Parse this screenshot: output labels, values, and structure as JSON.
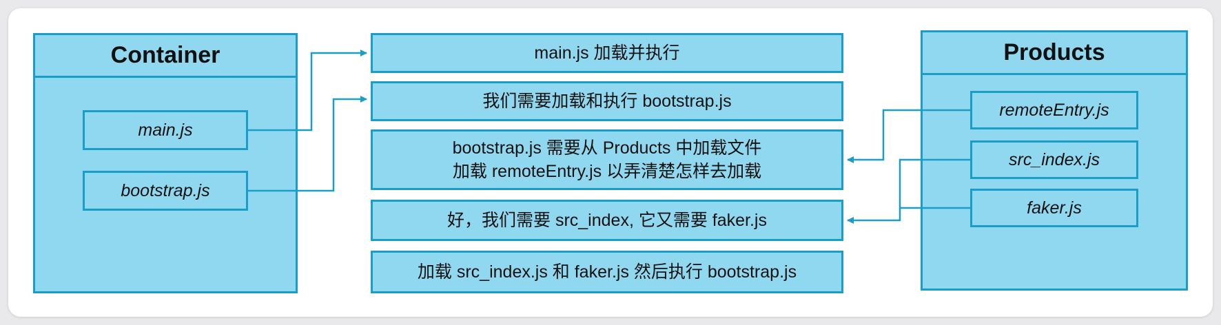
{
  "container": {
    "title": "Container",
    "files": [
      "main.js",
      "bootstrap.js"
    ]
  },
  "products": {
    "title": "Products",
    "files": [
      "remoteEntry.js",
      "src_index.js",
      "faker.js"
    ]
  },
  "steps": [
    {
      "lines": [
        "main.js 加载并执行"
      ]
    },
    {
      "lines": [
        "我们需要加载和执行 bootstrap.js"
      ]
    },
    {
      "lines": [
        "bootstrap.js 需要从 Products 中加载文件",
        "加载 remoteEntry.js 以弄清楚怎样去加载"
      ]
    },
    {
      "lines": [
        "好，我们需要 src_index, 它又需要 faker.js"
      ]
    },
    {
      "lines": [
        "加载 src_index.js 和 faker.js 然后执行 bootstrap.js"
      ]
    }
  ],
  "colors": {
    "box_fill": "#8fd8ef",
    "box_border": "#1a9ec9",
    "arrow": "#1a9ec9"
  }
}
